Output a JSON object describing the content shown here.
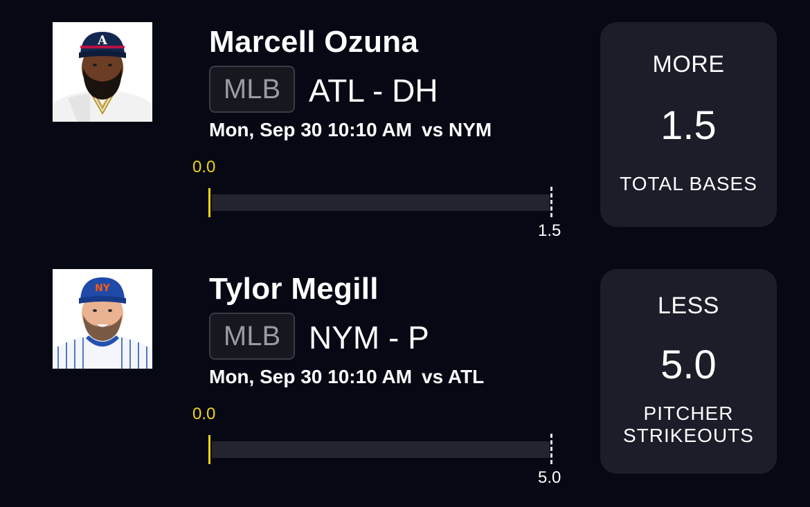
{
  "picks": [
    {
      "player_name": "Marcell Ozuna",
      "league": "MLB",
      "team_position": "ATL - DH",
      "game_time": "Mon, Sep 30 10:10 AM",
      "opponent": "vs NYM",
      "progress_label": "0.0",
      "line_label": "1.5",
      "progress_fraction": 0,
      "direction": "MORE",
      "line": "1.5",
      "stat": "TOTAL BASES",
      "avatar_icon": "player-headshot-atl"
    },
    {
      "player_name": "Tylor Megill",
      "league": "MLB",
      "team_position": "NYM - P",
      "game_time": "Mon, Sep 30 10:10 AM",
      "opponent": "vs ATL",
      "progress_label": "0.0",
      "line_label": "5.0",
      "progress_fraction": 0,
      "direction": "LESS",
      "line": "5.0",
      "stat": "PITCHER STRIKEOUTS",
      "avatar_icon": "player-headshot-nym"
    }
  ],
  "colors": {
    "background": "#060814",
    "card": "#1b1d29",
    "progress_accent": "#f5d40f",
    "bar_track": "#22242e"
  }
}
